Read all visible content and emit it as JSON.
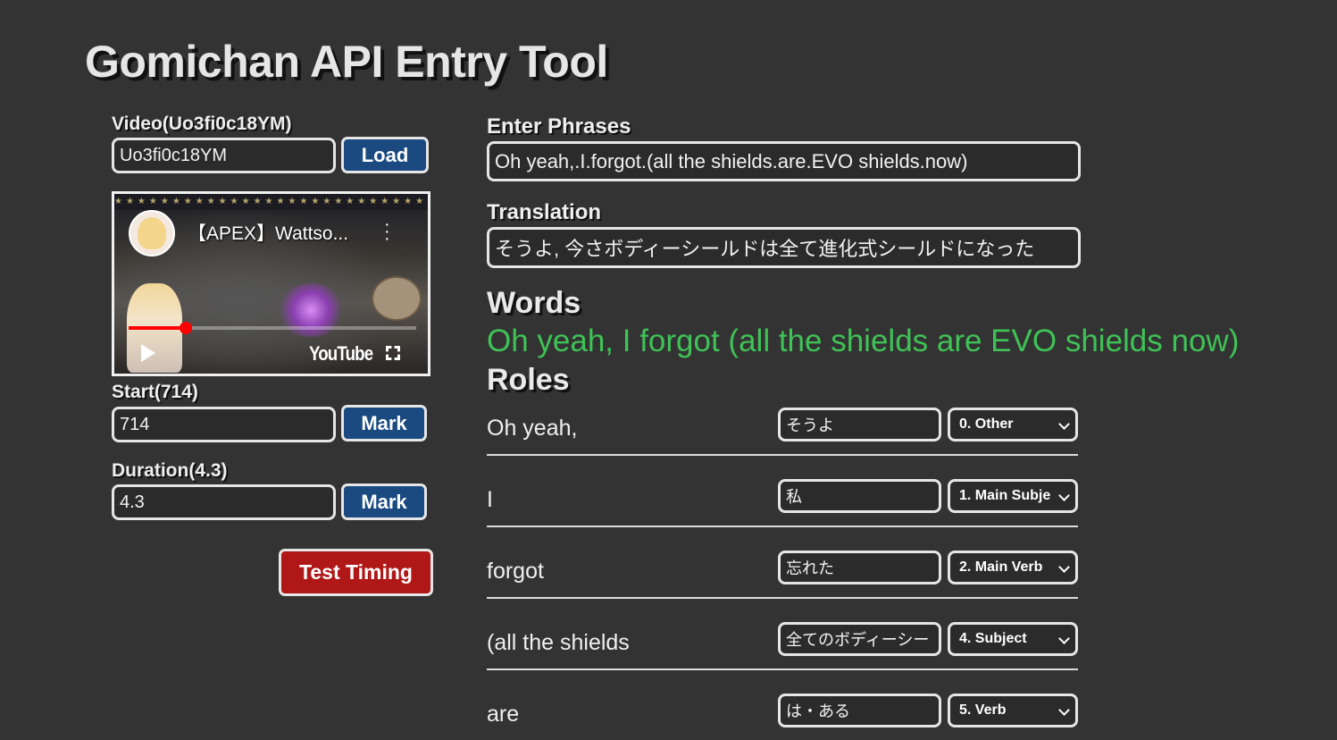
{
  "title": "Gomichan API Entry Tool",
  "left": {
    "video_label": "Video(Uo3fi0c18YM)",
    "video_id_value": "Uo3fi0c18YM",
    "load_label": "Load",
    "player": {
      "title": "【APEX】Wattso...",
      "brand": "YouTube",
      "progress_fraction": 0.2
    },
    "start_label": "Start(714)",
    "start_value": "714",
    "duration_label": "Duration(4.3)",
    "duration_value": "4.3",
    "mark_label": "Mark",
    "test_timing_label": "Test Timing"
  },
  "right": {
    "phrases_label": "Enter Phrases",
    "phrases_value": "Oh yeah,.I.forgot.(all the shields.are.EVO shields.now)",
    "translation_label": "Translation",
    "translation_value": "そうよ, 今さボディーシールドは全て進化式シールドになった",
    "words_heading": "Words",
    "words_sentence": "Oh yeah, I forgot (all the shields are EVO shields now)",
    "roles_heading": "Roles",
    "roles": [
      {
        "text": "Oh yeah,",
        "translation": "そうよ",
        "role": "0. Other"
      },
      {
        "text": "I",
        "translation": "私",
        "role": "1. Main Subje"
      },
      {
        "text": "forgot",
        "translation": "忘れた",
        "role": "2. Main Verb"
      },
      {
        "text": "(all the shields",
        "translation": "全てのボディーシー",
        "role": "4. Subject"
      },
      {
        "text": "are",
        "translation": "は・ある",
        "role": "5. Verb"
      }
    ]
  },
  "colors": {
    "background": "#333333",
    "button_blue": "#1a4a80",
    "button_red": "#b01717",
    "words_green": "#3fc256"
  }
}
